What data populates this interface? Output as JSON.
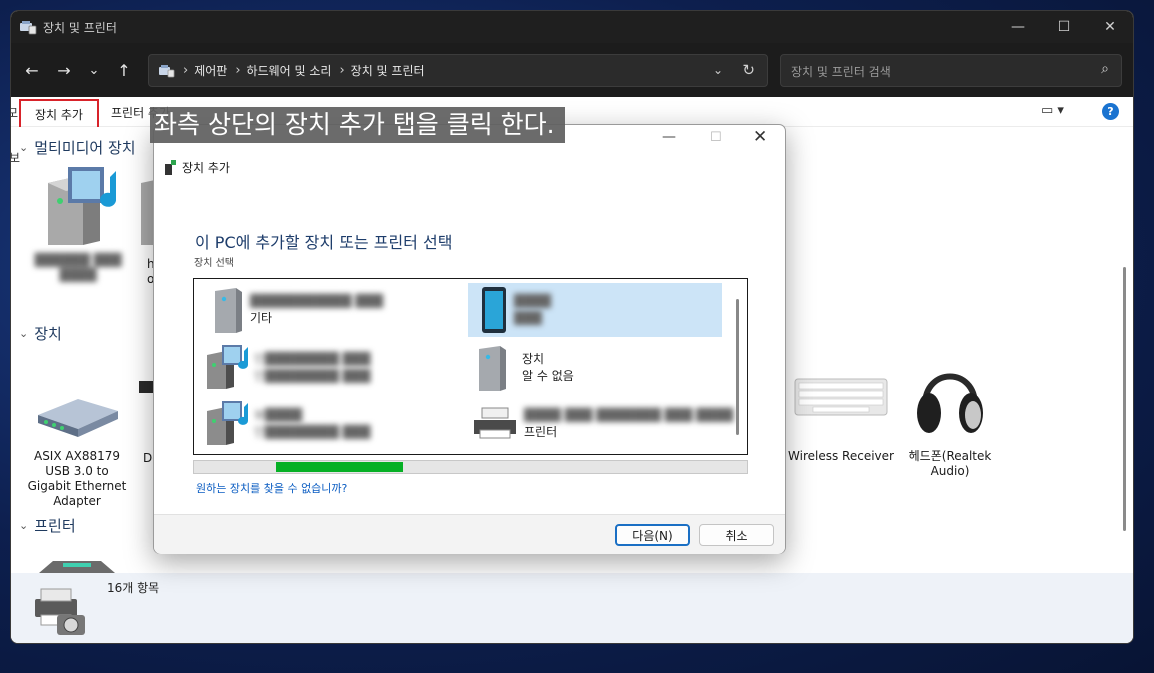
{
  "window": {
    "title": "장치 및 프린터",
    "controls": {
      "minimize": "—",
      "maximize": "☐",
      "close": "✕"
    }
  },
  "navigation": {
    "back": "←",
    "forward": "→",
    "recent": "⌄",
    "up": "↑",
    "breadcrumb": [
      "제어판",
      "하드웨어 및 소리",
      "장치 및 프린터"
    ],
    "separator": "›",
    "dropdown": "⌄",
    "refresh": "↻",
    "search_placeholder": "장치 및 프린터 검색",
    "search_icon": "⌕"
  },
  "toolbar": {
    "left_cut": "모",
    "add_device": "장치 추가",
    "add_printer": "프린터 추가",
    "view_icon": "▭ ▾",
    "help": "?"
  },
  "groups": {
    "multimedia": {
      "chevron": "⌄",
      "label": "멀티미디어 장치"
    },
    "devices": {
      "chevron": "⌄",
      "label": "장치"
    },
    "printers": {
      "chevron": "⌄",
      "label": "프린터"
    },
    "cut_label": "보"
  },
  "devices": {
    "media_blurred": "██████ ███ ████",
    "media_partial": "h\nor",
    "asix": "ASIX AX88179 USB 3.0 to Gigabit Ethernet Adapter",
    "de_partial": "De",
    "wireless": "Wireless Receiver",
    "headphones": "헤드폰(Realtek Audio)"
  },
  "status": {
    "count": "16개 항목"
  },
  "dialog": {
    "title": "장치 추가",
    "heading": "이 PC에 추가할 장치 또는 프린터 선택",
    "subheading": "장치 선택",
    "items": [
      {
        "name": "███████████ ███",
        "type": "기타",
        "selected": false
      },
      {
        "name": "████",
        "type": "███",
        "selected": true
      },
      {
        "name": "인████████ ███",
        "type": "인████████ ███",
        "selected": false
      },
      {
        "name": "장치",
        "type": "알 수 없음",
        "selected": false
      },
      {
        "name": "뷰████",
        "type": "인████████ ███",
        "selected": false
      },
      {
        "name": "████ ███ ███████ ███ ████",
        "type": "프린터",
        "selected": false
      }
    ],
    "progress": 0.23,
    "help_link": "원하는 장치를 찾을 수 없습니까?",
    "next": "다음(N)",
    "cancel": "취소",
    "close": "✕",
    "minimize": "—",
    "maximize": "☐"
  },
  "caption": "좌측 상단의 장치 추가 탭을 클릭 한다."
}
